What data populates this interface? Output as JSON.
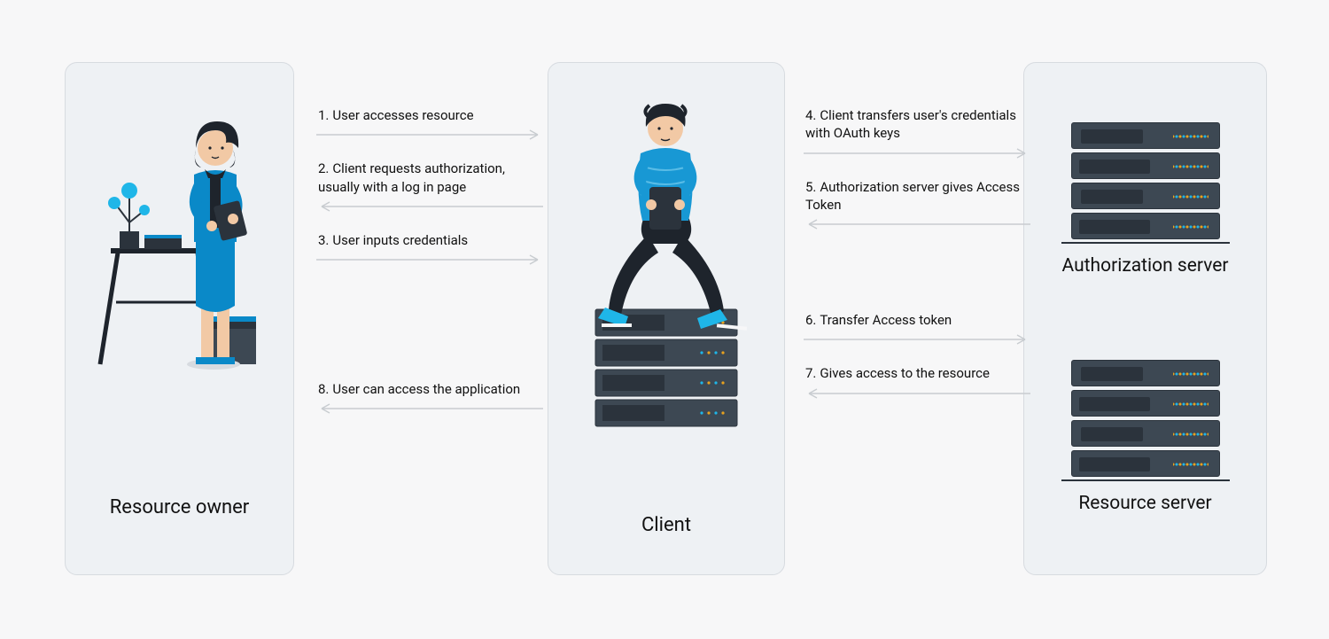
{
  "entities": {
    "owner": "Resource owner",
    "client": "Client",
    "auth_server": "Authorization server",
    "resource_server": "Resource server"
  },
  "steps": {
    "s1": {
      "n": "1.",
      "t": "User accesses resource"
    },
    "s2": {
      "n": "2.",
      "t": "Client requests authorization, usually with a log in page"
    },
    "s3": {
      "n": "3.",
      "t": "User inputs credentials"
    },
    "s4": {
      "n": "4.",
      "t": "Client transfers user's credentials with OAuth keys"
    },
    "s5": {
      "n": "5.",
      "t": "Authorization server gives Access Token"
    },
    "s6": {
      "n": "6.",
      "t": "Transfer Access token"
    },
    "s7": {
      "n": "7.",
      "t": "Gives access to the resource"
    },
    "s8": {
      "n": "8.",
      "t": "User can access the application"
    }
  }
}
